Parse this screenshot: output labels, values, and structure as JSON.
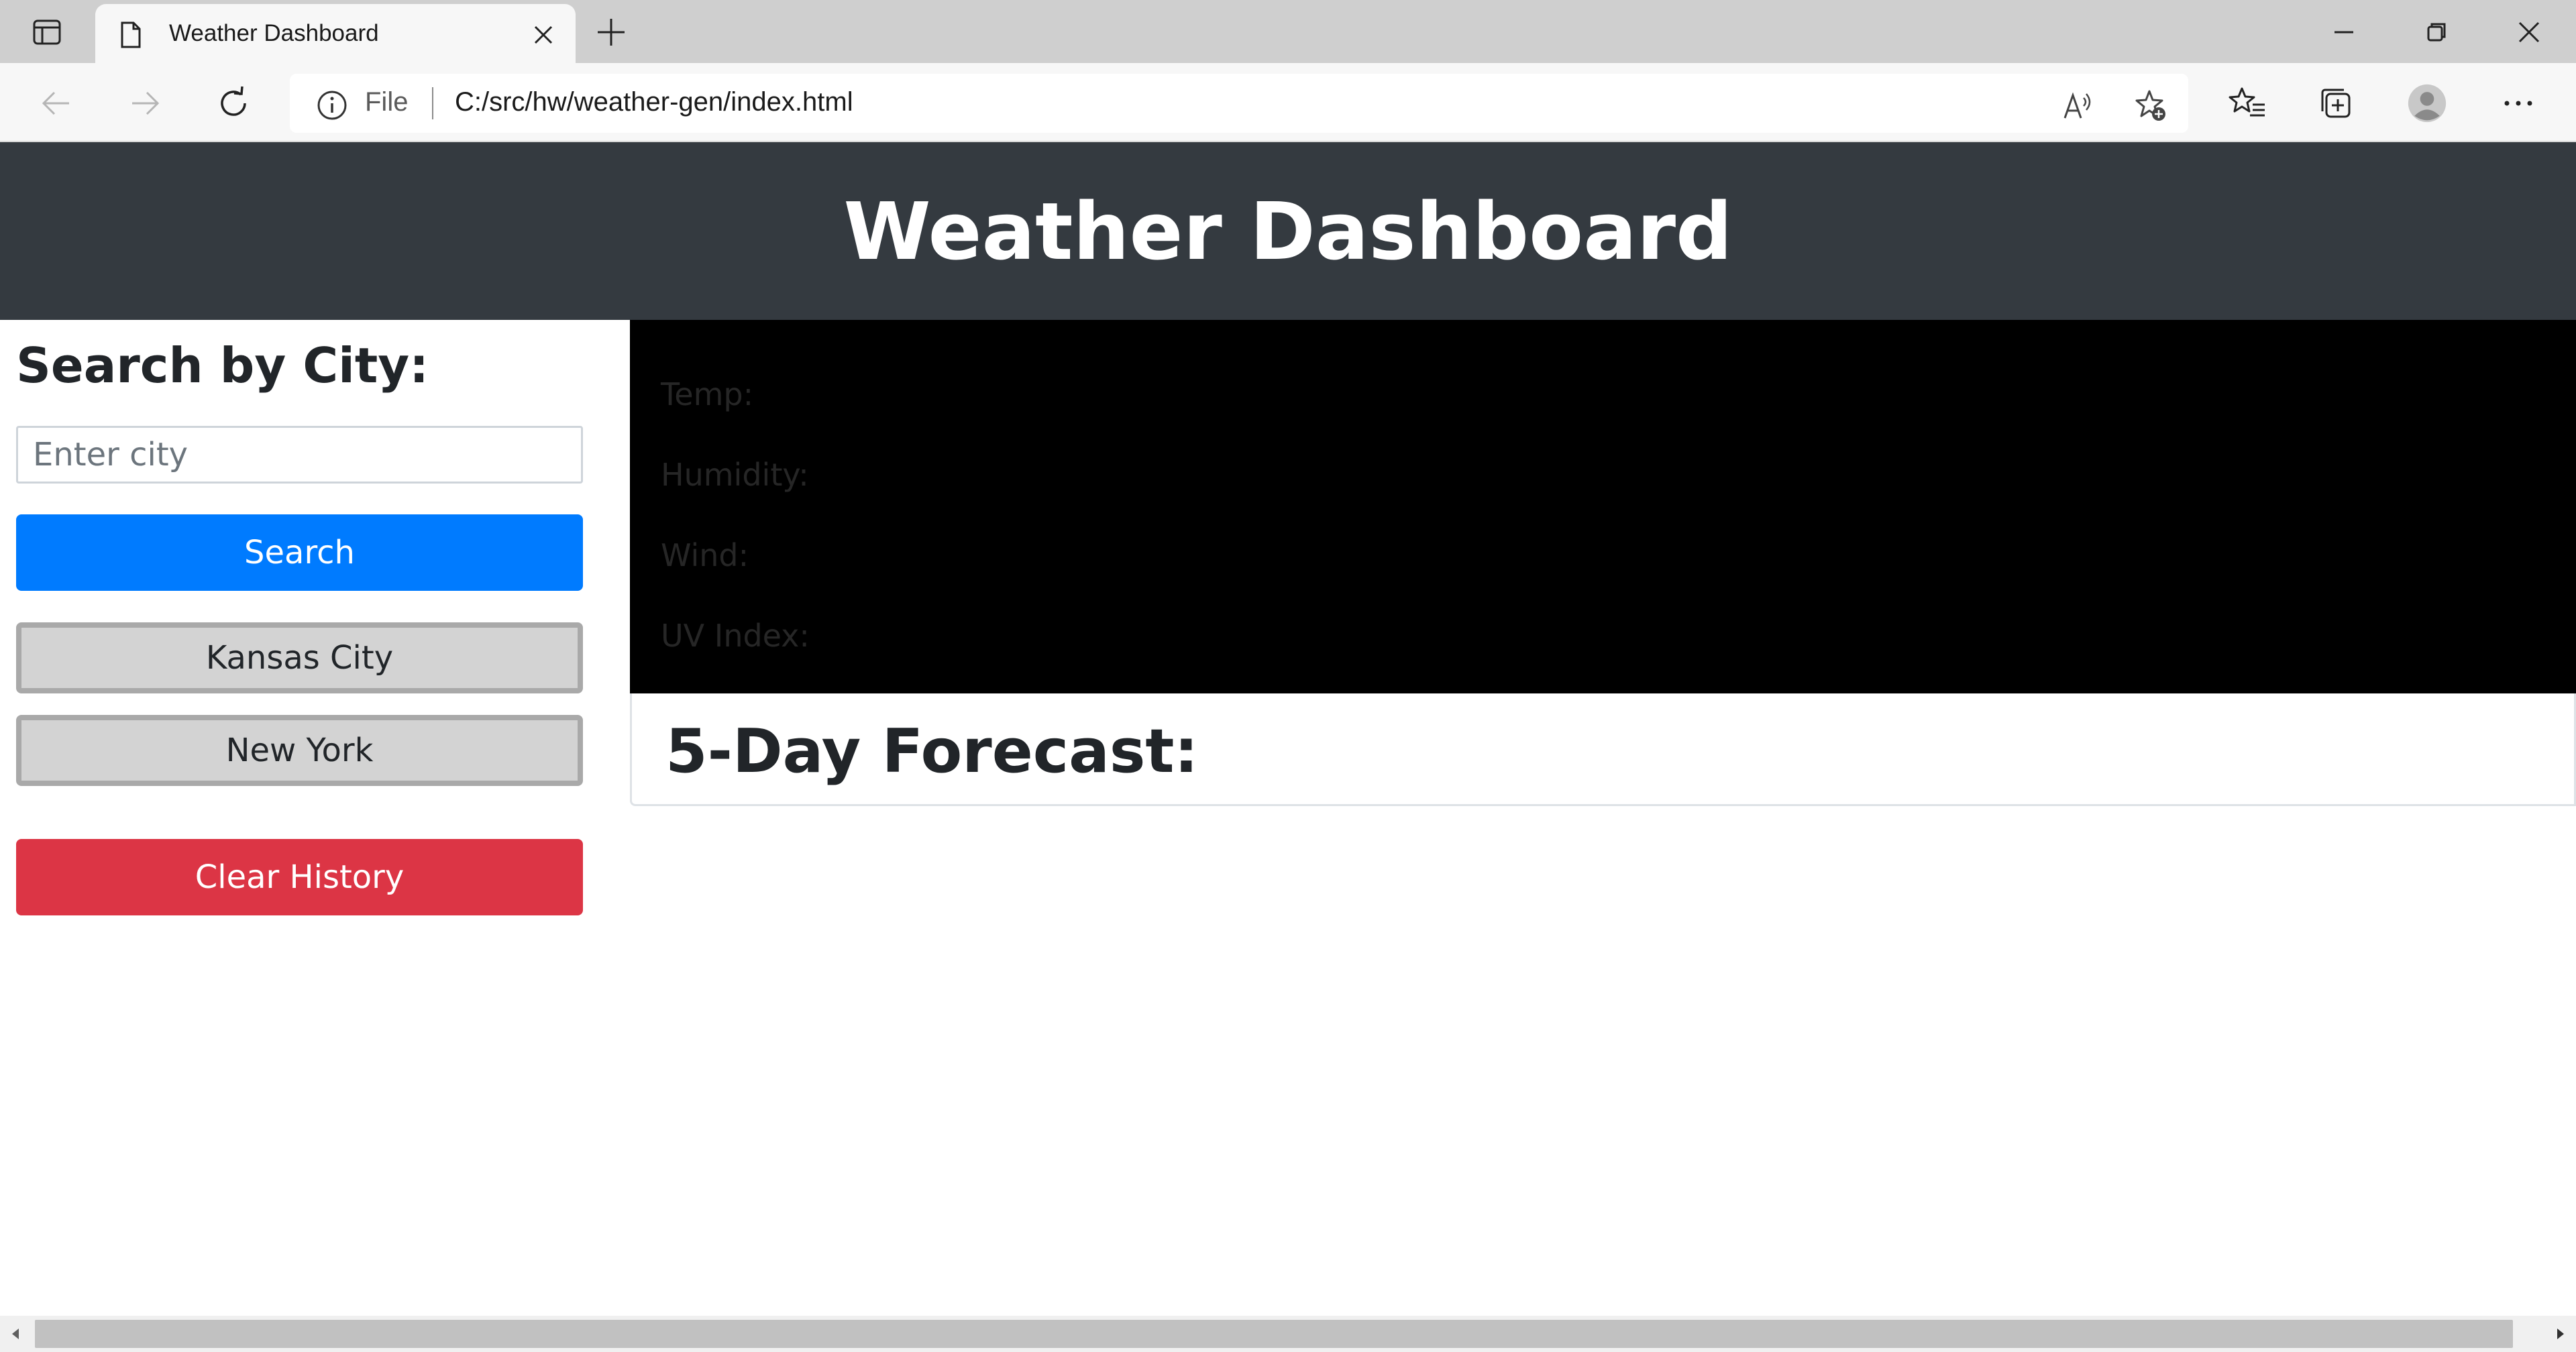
{
  "browser": {
    "tab_title": "Weather Dashboard",
    "url_scheme_label": "File",
    "url": "C:/src/hw/weather-gen/index.html"
  },
  "header": {
    "title": "Weather Dashboard"
  },
  "sidebar": {
    "title": "Search by City:",
    "search_placeholder": "Enter city",
    "search_value": "",
    "search_button": "Search",
    "history": [
      {
        "label": "Kansas City"
      },
      {
        "label": "New York"
      }
    ],
    "clear_button": "Clear History"
  },
  "current_weather": {
    "temp_label": "Temp:",
    "humidity_label": "Humidity:",
    "wind_label": "Wind:",
    "uv_label": "UV Index:"
  },
  "forecast": {
    "title": "5-Day Forecast:"
  },
  "colors": {
    "header_bg": "#343a40",
    "search_button": "#007bff",
    "clear_button": "#dc3545",
    "history_button": "#d3d3d3",
    "current_weather_bg": "#000000"
  }
}
